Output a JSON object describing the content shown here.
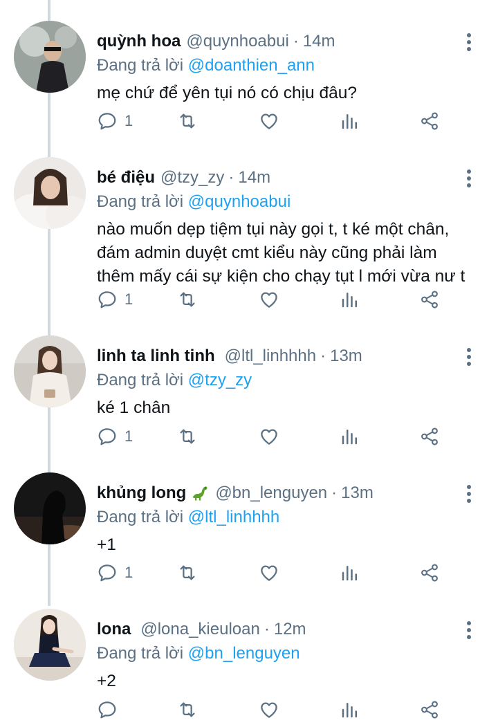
{
  "reply_prefix": "Đang trả lời",
  "tweets": [
    {
      "name": "quỳnh hoa",
      "handle": "@quynhoabui",
      "sep": "·",
      "time": "14m",
      "reply_to": "@doanthien_ann",
      "text_lines": [
        "mẹ chứ để yên tụi nó có chịu đâu?"
      ],
      "reply_count": "1",
      "avatar_colors": [
        "#8a8f8c",
        "#2b2b2b"
      ]
    },
    {
      "name": "bé điệu",
      "handle": "@tzy_zy",
      "sep": "·",
      "time": "14m",
      "reply_to": "@quynhoabui",
      "text_lines": [
        "nào muốn dẹp tiệm tụi này gọi t, t ké một chân,",
        "đám admin duyệt cmt kiểu này cũng phải làm",
        "thêm mấy cái sự kiện cho chạy tụt l mới vừa nư t"
      ],
      "reply_count": "1",
      "avatar_colors": [
        "#e9e6e2",
        "#3a2a22"
      ]
    },
    {
      "name": "linh ta linh tinh",
      "handle": "@ltl_linhhhh",
      "sep": "·",
      "time": "13m",
      "reply_to": "@tzy_zy",
      "text_lines": [
        "ké 1 chân"
      ],
      "reply_count": "1",
      "avatar_colors": [
        "#d7d2cc",
        "#f1ede6"
      ]
    },
    {
      "name": "khủng long",
      "handle": "@bn_lenguyen",
      "sep": "·",
      "time": "13m",
      "reply_to": "@ltl_linhhhh",
      "text_lines": [
        "+1"
      ],
      "reply_count": "1",
      "avatar_colors": [
        "#1a1a1a",
        "#6b4a3a"
      ]
    },
    {
      "name": "lona",
      "handle": "@lona_kieuloan",
      "sep": "·",
      "time": "12m",
      "reply_to": "@bn_lenguyen",
      "text_lines": [
        "+2"
      ],
      "reply_count": "",
      "avatar_colors": [
        "#efe9e4",
        "#1c2440"
      ]
    }
  ],
  "icons": {
    "reply": "speech-bubble-icon",
    "retweet": "retweet-icon",
    "like": "heart-icon",
    "analytics": "bar-chart-icon",
    "share": "share-icon",
    "more": "vertical-dots-icon"
  },
  "colors": {
    "link": "#1da1f2",
    "secondary_text": "#5b7083",
    "thread_line": "#cfd9de"
  }
}
